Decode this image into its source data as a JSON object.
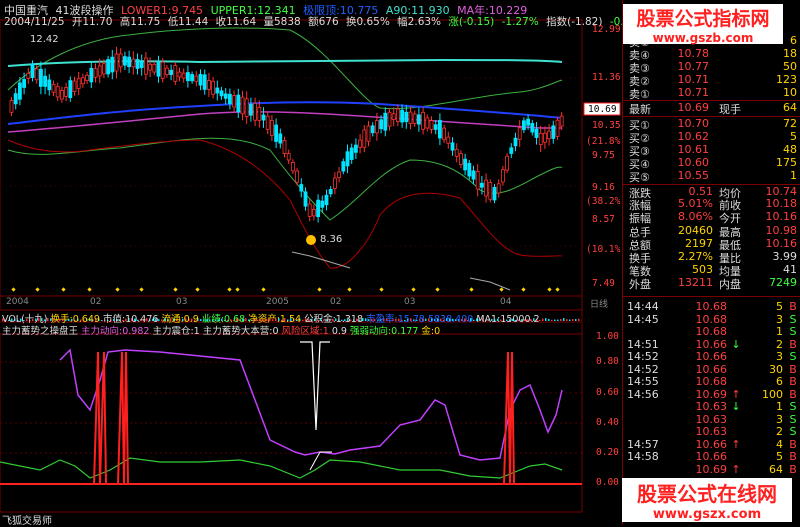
{
  "header": {
    "stock": "中国重汽",
    "strategy": "41波段操作",
    "lower": "LOWER1:9.745",
    "upper": "UPPER1:12.341",
    "boll": "极限顶:10.775",
    "a90": "A90:11.930",
    "ma": "MA年:10.229",
    "date": "2004/11/25",
    "open": "开11.70",
    "high": "高11.75",
    "low": "低11.44",
    "close": "收11.64",
    "vol": "量5838",
    "amount": "额676",
    "turnover": "换0.65%",
    "amp": "幅2.63%",
    "change": "涨(-0.15)",
    "changepct": "-1.27%",
    "index": "指数(-1.82)",
    "index2": "-0.05"
  },
  "price_axis": [
    "12.99",
    "12.40",
    "11.96",
    "11.36",
    "10.69",
    "10.35",
    "9.75",
    "9.16",
    "8.57",
    "7.98",
    "7.49"
  ],
  "pct_axis": [
    "(21.8%)",
    "(38.2%)",
    "(61.8%)",
    "(10.1%)"
  ],
  "annotations": {
    "high_mark": "12.42",
    "low_mark": "8.36"
  },
  "current_price_tag": "10.69",
  "date_axis": [
    "2004",
    "02",
    "03",
    "2005",
    "02",
    "03",
    "04",
    "日线"
  ],
  "vol_bar": {
    "title": "VOL(十九)",
    "items": [
      "换手:0.649",
      "市值:10.476",
      "流通:0.9",
      "业绩:0.68",
      "净资产:1.54",
      "公积金:1.318",
      "市盈率:15.78",
      "5838.400",
      "MA1:15000.2"
    ]
  },
  "indicator_bar": {
    "title": "主力蓄势之操盘王",
    "items": [
      "主力动向:0.982",
      "主力震仓:1",
      "主力蓄势大本营:0",
      "风险区域:1",
      "0.9",
      "强弱动向:0.177",
      "金:0"
    ]
  },
  "ind_axis": [
    "1.00",
    "0.80",
    "0.60",
    "0.40",
    "0.20",
    "0.00"
  ],
  "footer": "飞狐交易师",
  "watermark_top": {
    "title": "股票公式指标网",
    "url": "www.gszb.com"
  },
  "watermark_bottom": {
    "title": "股票公式在线网",
    "url": "www.gszx.com"
  },
  "asks": [
    {
      "label": "卖⑤",
      "price": "10.79",
      "vol": "6"
    },
    {
      "label": "卖④",
      "price": "10.78",
      "vol": "18"
    },
    {
      "label": "卖③",
      "price": "10.77",
      "vol": "50"
    },
    {
      "label": "卖②",
      "price": "10.71",
      "vol": "123"
    },
    {
      "label": "卖①",
      "price": "10.71",
      "vol": "10"
    }
  ],
  "last": {
    "label": "最新",
    "price": "10.69",
    "label2": "现手",
    "vol": "64"
  },
  "bids": [
    {
      "label": "买①",
      "price": "10.70",
      "vol": "72"
    },
    {
      "label": "买②",
      "price": "10.62",
      "vol": "5"
    },
    {
      "label": "买③",
      "price": "10.61",
      "vol": "48"
    },
    {
      "label": "买④",
      "price": "10.60",
      "vol": "175"
    },
    {
      "label": "买⑤",
      "price": "10.55",
      "vol": "1"
    }
  ],
  "stats": [
    {
      "l1": "涨跌",
      "v1": "0.51",
      "l2": "均价",
      "v2": "10.74"
    },
    {
      "l1": "涨幅",
      "v1": "5.01%",
      "l2": "前收",
      "v2": "10.18"
    },
    {
      "l1": "振幅",
      "v1": "8.06%",
      "l2": "今开",
      "v2": "10.16"
    },
    {
      "l1": "总手",
      "v1": "20460",
      "l2": "最高",
      "v2": "10.98"
    },
    {
      "l1": "总额",
      "v1": "2197",
      "l2": "最低",
      "v2": "10.16"
    },
    {
      "l1": "换手",
      "v1": "2.27%",
      "l2": "量比",
      "v2": "3.99"
    },
    {
      "l1": "笔数",
      "v1": "503",
      "l2": "均量",
      "v2": "41"
    },
    {
      "l1": "外盘",
      "v1": "13211",
      "l2": "内盘",
      "v2": "7249"
    }
  ],
  "ticks": [
    {
      "t": "14:44",
      "p": "10.68",
      "a": "",
      "v": "5",
      "bs": "B"
    },
    {
      "t": "14:45",
      "p": "10.68",
      "a": "",
      "v": "3",
      "bs": "S"
    },
    {
      "t": "",
      "p": "10.68",
      "a": "",
      "v": "1",
      "bs": "S"
    },
    {
      "t": "14:51",
      "p": "10.66",
      "a": "↓",
      "v": "2",
      "bs": "B"
    },
    {
      "t": "14:52",
      "p": "10.66",
      "a": "",
      "v": "3",
      "bs": "S"
    },
    {
      "t": "14:52",
      "p": "10.66",
      "a": "",
      "v": "30",
      "bs": "B"
    },
    {
      "t": "14:55",
      "p": "10.68",
      "a": "",
      "v": "6",
      "bs": "B"
    },
    {
      "t": "14:56",
      "p": "10.69",
      "a": "↑",
      "v": "100",
      "bs": "B"
    },
    {
      "t": "",
      "p": "10.63",
      "a": "↓",
      "v": "1",
      "bs": "S"
    },
    {
      "t": "",
      "p": "10.63",
      "a": "",
      "v": "3",
      "bs": "S"
    },
    {
      "t": "",
      "p": "10.63",
      "a": "",
      "v": "2",
      "bs": "S"
    },
    {
      "t": "14:57",
      "p": "10.66",
      "a": "↑",
      "v": "4",
      "bs": "B"
    },
    {
      "t": "14:58",
      "p": "10.66",
      "a": "",
      "v": "5",
      "bs": "B"
    },
    {
      "t": "",
      "p": "10.69",
      "a": "↑",
      "v": "64",
      "bs": "B"
    }
  ],
  "colors": {
    "up": "#ff3030",
    "down": "#00ffff",
    "bg": "#000000",
    "frame": "#7a0000",
    "accent": "#ffd400"
  }
}
